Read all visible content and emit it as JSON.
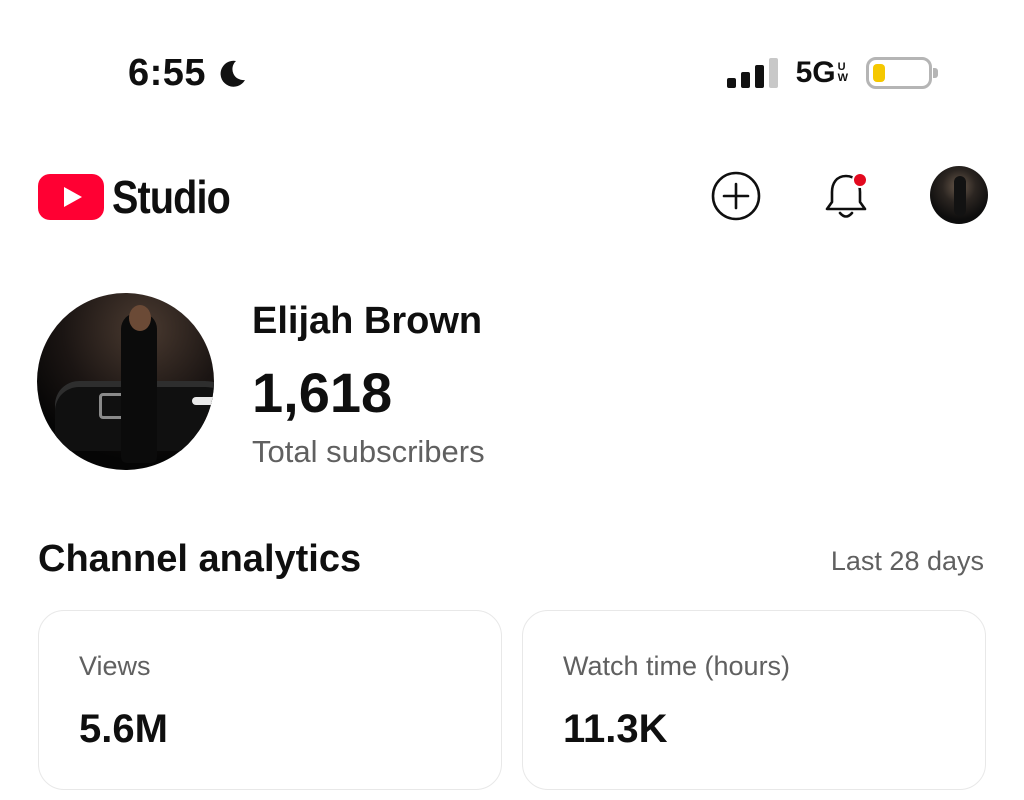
{
  "status_bar": {
    "time": "6:55",
    "network": "5G",
    "network_sup": "U",
    "network_sub": "W",
    "battery_level": 0.12,
    "battery_color": "#f5c800",
    "signal_bars": 3,
    "moon_icon": "moon-icon"
  },
  "header": {
    "app_name": "Studio",
    "brand_color": "#ff0033",
    "create_icon": "plus-circle-icon",
    "notifications_icon": "bell-icon",
    "notification_dot_color": "#e3091f"
  },
  "channel": {
    "name": "Elijah Brown",
    "subscribers": "1,618",
    "subscribers_label": "Total subscribers"
  },
  "analytics": {
    "title": "Channel analytics",
    "period": "Last 28 days",
    "cards": [
      {
        "label": "Views",
        "value": "5.6M"
      },
      {
        "label": "Watch time (hours)",
        "value": "11.3K"
      }
    ]
  }
}
